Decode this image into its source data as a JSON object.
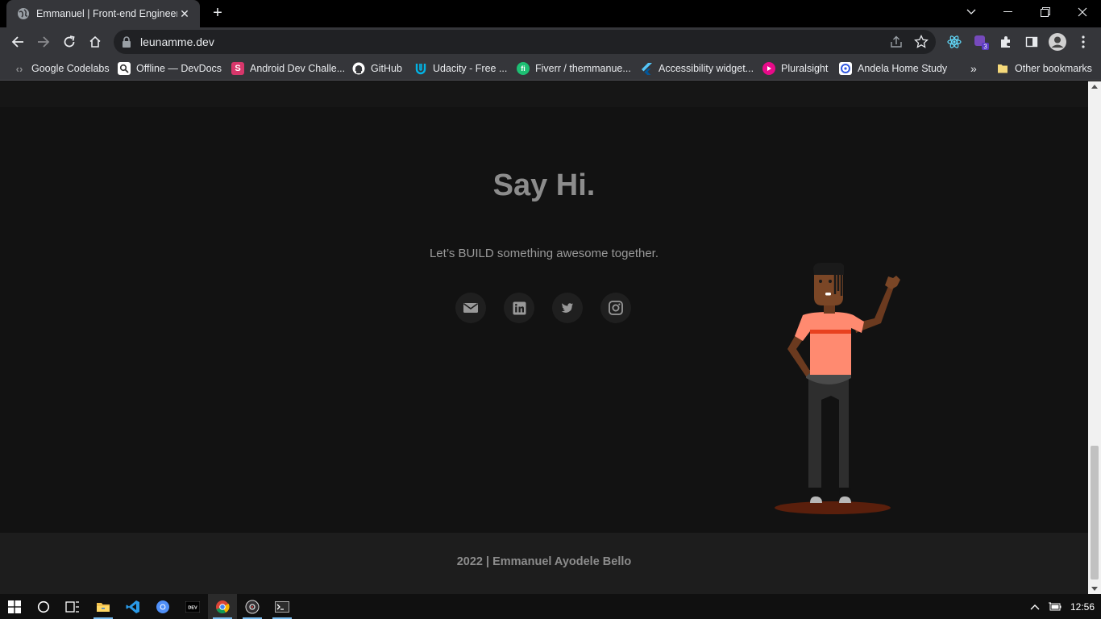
{
  "browser": {
    "tab_title": "Emmanuel | Front-end Engineer",
    "url": "leunamme.dev",
    "extension_badge": "3"
  },
  "bookmarks": [
    {
      "label": "Google Codelabs",
      "icon": "codelabs-icon",
      "color": "#5f6368"
    },
    {
      "label": "Offline — DevDocs",
      "icon": "devdocs-icon",
      "color": "#ffffff"
    },
    {
      "label": "Android Dev Challe...",
      "icon": "android-dev-icon",
      "color": "#d7376b"
    },
    {
      "label": "GitHub",
      "icon": "github-icon",
      "color": "#ffffff"
    },
    {
      "label": "Udacity - Free ...",
      "icon": "udacity-icon",
      "color": "#02b3e4"
    },
    {
      "label": "Fiverr / themmanue...",
      "icon": "fiverr-icon",
      "color": "#1dbf73"
    },
    {
      "label": "Accessibility widget...",
      "icon": "flutter-icon",
      "color": "#54c5f8"
    },
    {
      "label": "Pluralsight",
      "icon": "pluralsight-icon",
      "color": "#f15b2a"
    },
    {
      "label": "Andela Home Study",
      "icon": "andela-icon",
      "color": "#3359df"
    }
  ],
  "bookmarks_overflow": "»",
  "other_bookmarks": "Other bookmarks",
  "page": {
    "heading": "Say Hi.",
    "tagline": "Let’s BUILD something awesome together.",
    "social": [
      {
        "name": "email-icon"
      },
      {
        "name": "linkedin-icon"
      },
      {
        "name": "twitter-icon"
      },
      {
        "name": "instagram-icon"
      }
    ],
    "footer": "2022 | Emmanuel Ayodele Bello"
  },
  "taskbar": {
    "clock": "12:56",
    "apps": [
      "start-icon",
      "cortana-icon",
      "task-view-icon",
      "file-explorer-icon",
      "vscode-icon",
      "chromium-icon",
      "dev-icon",
      "chrome-icon",
      "obs-icon",
      "terminal-icon"
    ]
  },
  "colors": {
    "page_bg": "#121212",
    "footer_bg": "#1d1d1d",
    "heading": "#8c8c8c",
    "shirt": "#ff8a70",
    "skin": "#7a4626"
  }
}
